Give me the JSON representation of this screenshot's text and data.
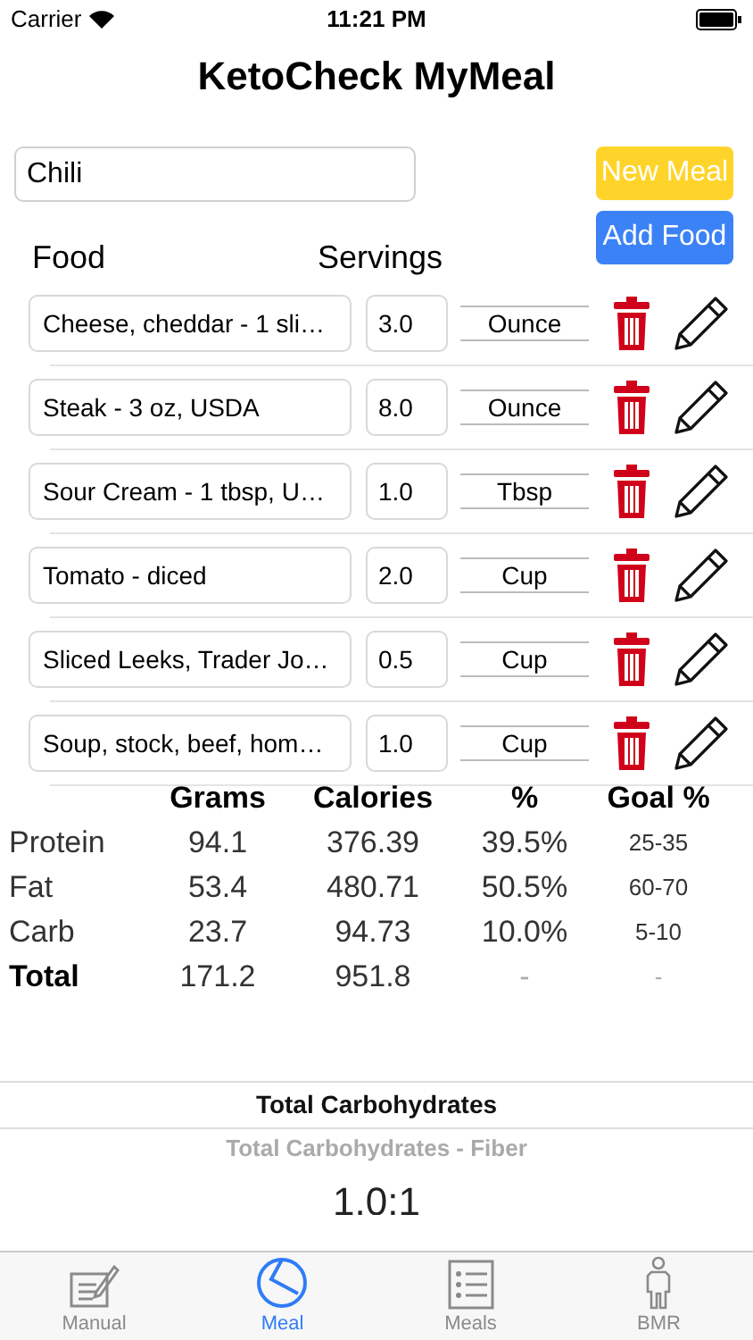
{
  "status_bar": {
    "carrier": "Carrier",
    "time": "11:21 PM"
  },
  "title": "KetoCheck MyMeal",
  "meal_name": {
    "value": "Chili"
  },
  "buttons": [
    {
      "label": "New Meal",
      "kind": "yellow"
    },
    {
      "label": "Add Food",
      "kind": "blue"
    }
  ],
  "columns": [
    "Food",
    "Servings"
  ],
  "foods": [
    {
      "name": "Cheese, cheddar - 1 sli…",
      "servings": "3.0",
      "unit": "Ounce"
    },
    {
      "name": "Steak - 3 oz, USDA",
      "servings": "8.0",
      "unit": "Ounce"
    },
    {
      "name": "Sour Cream - 1 tbsp, U…",
      "servings": "1.0",
      "unit": "Tbsp"
    },
    {
      "name": "Tomato - diced",
      "servings": "2.0",
      "unit": "Cup"
    },
    {
      "name": "Sliced Leeks, Trader Jo…",
      "servings": "0.5",
      "unit": "Cup"
    },
    {
      "name": "Soup, stock, beef, hom…",
      "servings": "1.0",
      "unit": "Cup"
    }
  ],
  "summary": {
    "columns": [
      "Grams",
      "Calories",
      "%",
      "Goal %"
    ],
    "rows": [
      {
        "label": "Protein",
        "bold": false,
        "cells": [
          "94.1",
          "376.39",
          "39.5%",
          "25-35"
        ]
      },
      {
        "label": "Fat",
        "bold": false,
        "cells": [
          "53.4",
          "480.71",
          "50.5%",
          "60-70"
        ]
      },
      {
        "label": "Carb",
        "bold": false,
        "cells": [
          "23.7",
          "94.73",
          "10.0%",
          "5-10"
        ]
      },
      {
        "label": "Total",
        "bold": true,
        "cells": [
          "171.2",
          "951.8",
          "-",
          "-"
        ]
      }
    ]
  },
  "carb_picker": [
    {
      "label": "Total Carbohydrates",
      "selected": true
    },
    {
      "label": "Total Carbohydrates - Fiber",
      "selected": false
    }
  ],
  "ratio": "1.0:1",
  "tabs": [
    {
      "label": "Manual",
      "kind": "manual",
      "selected": false
    },
    {
      "label": "Meal",
      "kind": "meal",
      "selected": true
    },
    {
      "label": "Meals",
      "kind": "meals",
      "selected": false
    },
    {
      "label": "BMR",
      "kind": "bmr",
      "selected": false
    }
  ]
}
